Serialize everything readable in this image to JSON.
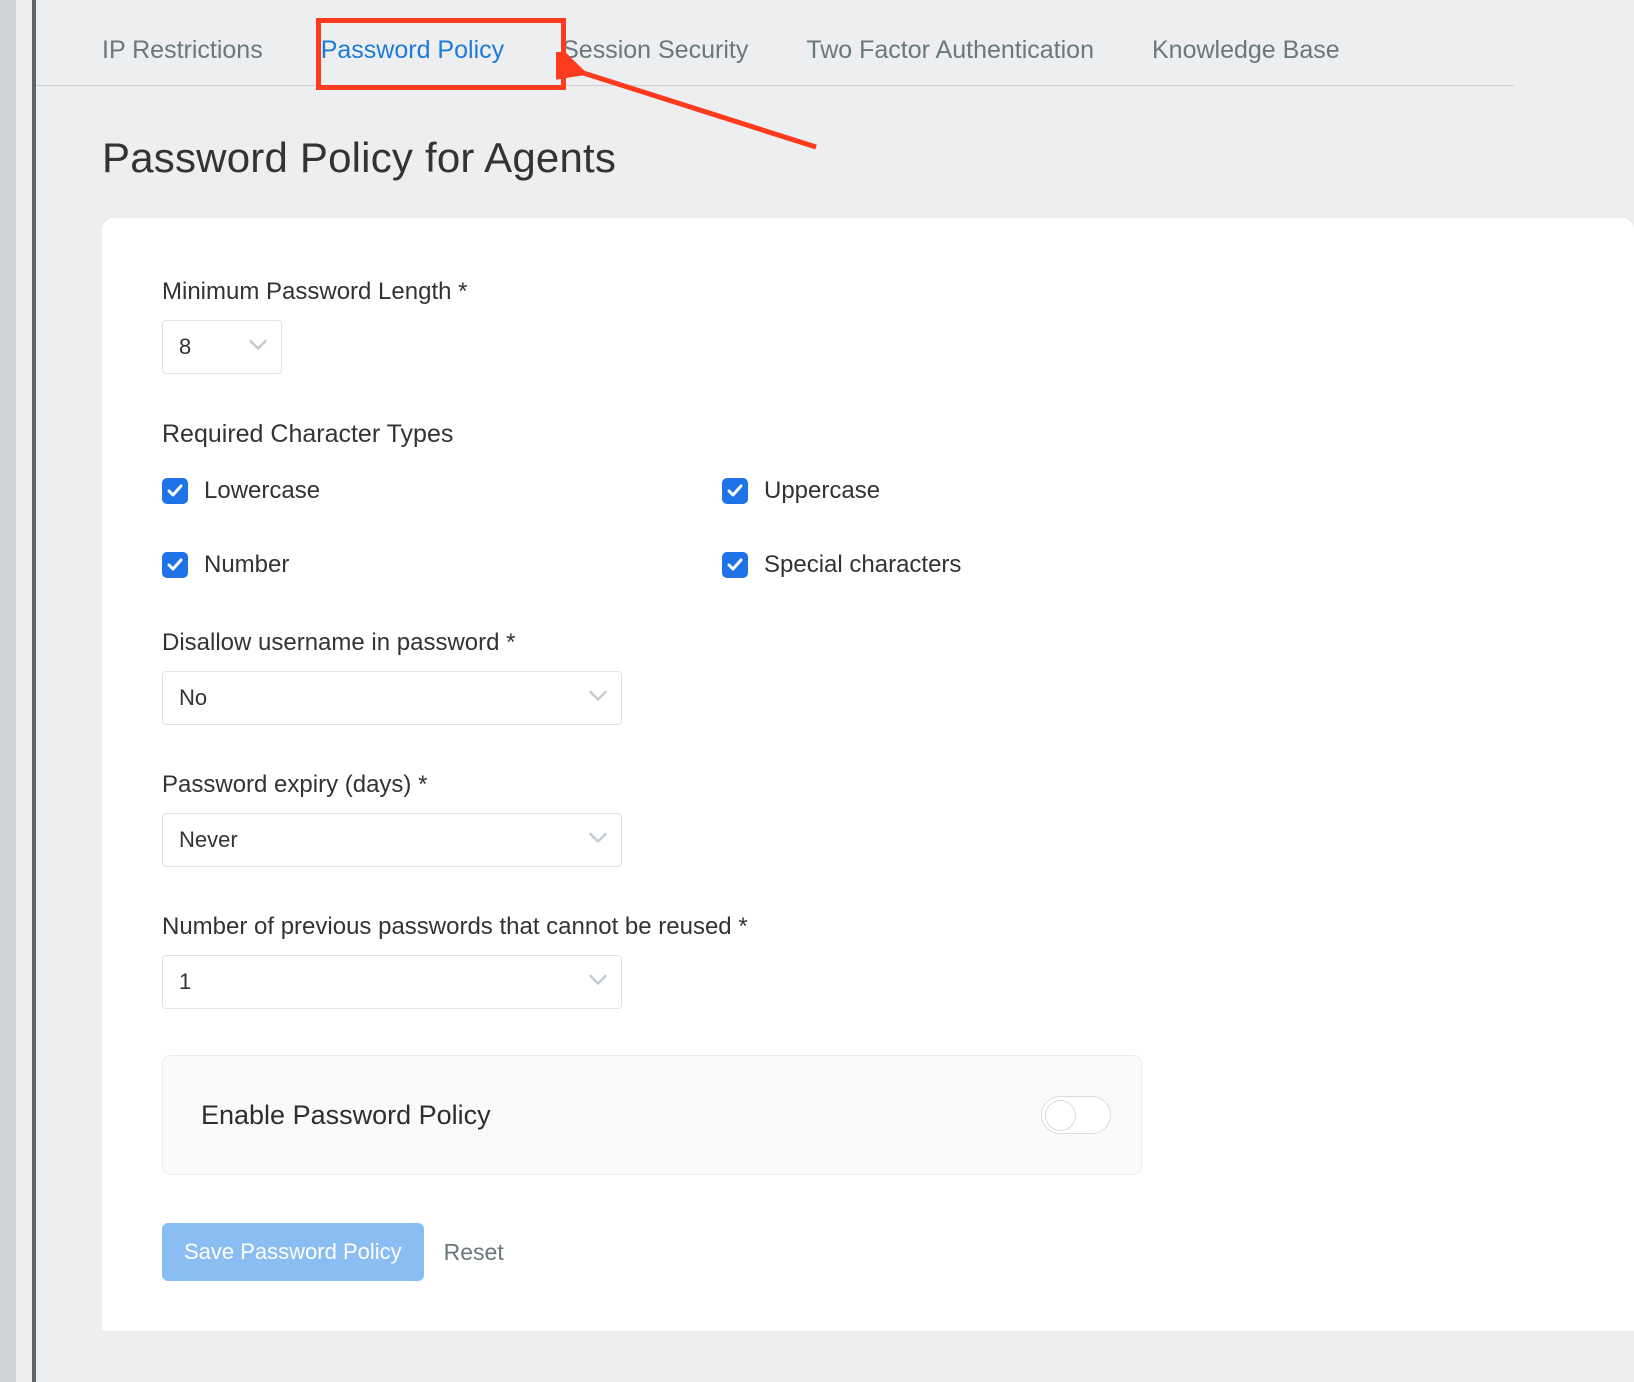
{
  "tabs": {
    "ip_restrictions": "IP Restrictions",
    "password_policy": "Password Policy",
    "session_security": "Session Security",
    "two_factor": "Two Factor Authentication",
    "knowledge_base": "Knowledge Base"
  },
  "page_title": "Password Policy for Agents",
  "form": {
    "min_length_label": "Minimum Password Length *",
    "min_length_value": "8",
    "required_chars_label": "Required Character Types",
    "chars": {
      "lowercase": "Lowercase",
      "uppercase": "Uppercase",
      "number": "Number",
      "special": "Special characters"
    },
    "disallow_username_label": "Disallow username in password *",
    "disallow_username_value": "No",
    "expiry_label": "Password expiry (days) *",
    "expiry_value": "Never",
    "reuse_label": "Number of previous passwords that cannot be reused *",
    "reuse_value": "1",
    "enable_label": "Enable Password Policy",
    "save_button": "Save Password Policy",
    "reset_button": "Reset"
  }
}
